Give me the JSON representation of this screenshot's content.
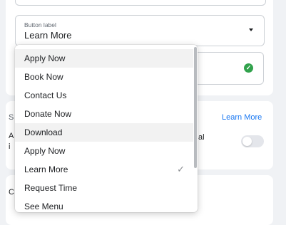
{
  "form": {
    "button_label": {
      "label": "Button label",
      "value": "Learn More"
    },
    "link_text": "Learn More",
    "frag_s": "S",
    "frag_a": "A",
    "frag_i": "i",
    "frag_c": "C",
    "frag_al": "al",
    "toggle": {
      "on": false
    }
  },
  "dropdown": {
    "items": [
      {
        "label": "Apply Now"
      },
      {
        "label": "Book Now"
      },
      {
        "label": "Contact Us"
      },
      {
        "label": "Donate Now"
      },
      {
        "label": "Download"
      },
      {
        "label": "Apply Now"
      },
      {
        "label": "Learn More",
        "check": "✓"
      },
      {
        "label": "Request Time"
      },
      {
        "label": "See Menu"
      }
    ]
  },
  "colors": {
    "accent": "#1877f2",
    "success": "#31a24c",
    "highlight": "#f2f2f2"
  }
}
